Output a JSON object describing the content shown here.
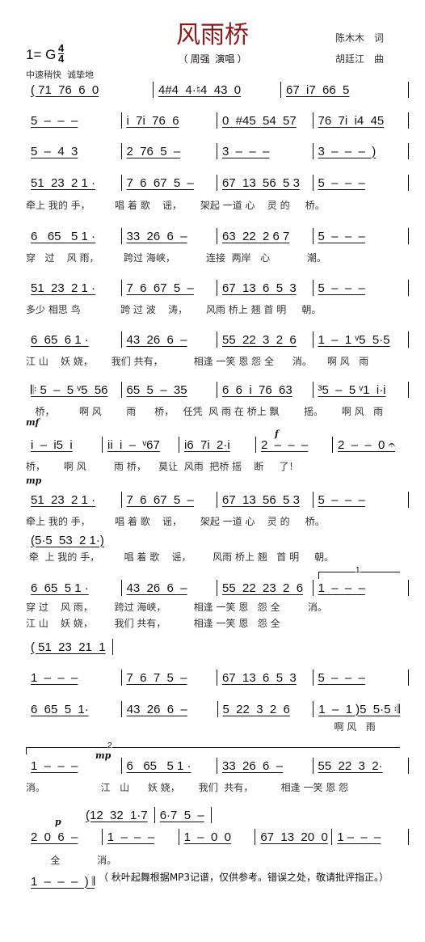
{
  "header": {
    "title": "风雨桥",
    "lyricist": "陈木木　词",
    "composer": "胡廷江　曲",
    "key": "1= G",
    "time_top": "4",
    "time_bottom": "4",
    "singer": "（ 周强  演唱 ）",
    "tempo": "中速稍快  诚挚地"
  },
  "dynamics": {
    "mf": "mf",
    "mp1": "mp",
    "f": "f",
    "mp2": "mp",
    "p": "p"
  },
  "voltas": {
    "v1": "1",
    "v2": "2"
  },
  "rows": [
    {
      "notes": [
        "( 71  76  6  0",
        "4#4  4·♮4  43  0",
        "67  i7  66  5",
        ""
      ],
      "lyrics": ""
    },
    {
      "notes": [
        "5  –  –  –",
        "i  7i  76  6",
        "0  #45  54  57",
        "76  7i  i4  45",
        ""
      ],
      "lyrics": ""
    },
    {
      "notes": [
        "5  –  4  3",
        "2  76  5  –",
        "3  –  –  –",
        "3  –  –  –  )",
        ""
      ],
      "lyrics": ""
    },
    {
      "notes": [
        "51  23  2 1 ·",
        "7  6  67  5  –",
        "67  13  56  5 3",
        "5  –  –  –",
        ""
      ],
      "lyrics": "牵上 我的 手，        唱 着 歌    谣，      架起 一道 心    灵 的     桥。"
    },
    {
      "notes": [
        "6   65   5 1 ·",
        "33  26  6  –",
        "63  22  2 6 7",
        "5  –  –  –",
        ""
      ],
      "lyrics": "穿   过    风 雨，        跨过 海峡，          连接  两岸   心            潮。"
    },
    {
      "notes": [
        "51  23  2 1 ·",
        "7  6  67  5  –",
        "67  13  6  5  3",
        "5  –  –  –",
        ""
      ],
      "lyrics": "多少 相思 鸟             跨 过 波    涛，      风雨 桥上 翘 首 明     朝。"
    },
    {
      "notes": [
        "6  65  6 1 ·",
        "43  26  6  –",
        "55  22  3  2  6",
        "1  –  1 ᵛ5  5·5",
        ""
      ],
      "lyrics": "江 山    妖 娆，      我们 共有，          相逢 一笑 恩 怨 全      消。     啊 风   雨"
    },
    {
      "notes": [
        "𝄆 5  –  5 ᵛ5  56",
        "65  5  –  35",
        "6  6  i  76  63",
        "³5  –  5 ᵛ1  i·i",
        ""
      ],
      "lyrics": "   桥，        啊 风        雨      桥，   任凭  风 雨 在 桥上 飘        摇。      啊 风   雨"
    },
    {
      "notes": [
        "i  –  i5  i",
        "ii  i  –  ᵛ67",
        "i6  7i  2·i",
        "2  –  –  –",
        "2  –  –  0 𝄐"
      ],
      "lyrics": "桥，      啊 风         雨 桥，    莫让  风雨  把桥 摇    断     了！"
    },
    {
      "notes": [
        "51  23  2 1 ·",
        "7  6  67  5  –",
        "67  13  56  5 3",
        "5  –  –  –",
        ""
      ],
      "lyrics": "牵上 我的 手，        唱 着 歌    谣，      架起 一道 心    灵 的     桥。"
    },
    {
      "notes": [
        "(5·5  53  2 1·)"
      ],
      "lyrics": " 牵  上 我的 手，        唱 着 歌    谣，       风雨 桥上 翘   首 明     朝。"
    },
    {
      "notes": [
        "6  65  5 1 ·",
        "43  26  6  –",
        "55  22  23  2  6",
        "1  –  –  –",
        ""
      ],
      "lyrics": "穿 过    风 雨，       跨过 海峡，         相逢 一笑 恩   怨 全         消。"
    },
    {
      "notes": [],
      "lyrics": "江 山    妖 娆，       我们 共有，         相逢 一笑 恩   怨 全"
    },
    {
      "notes": [
        "( 51  23  21  1",
        ""
      ],
      "lyrics": ""
    },
    {
      "notes": [
        "1  –  –  –",
        "7  6  7  5  –",
        "67  13  6  5  3",
        "5  –  –  –",
        ""
      ],
      "lyrics": ""
    },
    {
      "notes": [
        "6  65  5  1·",
        "43  26  6  –",
        "5  22  3  2  6",
        "1  –  1 )5  5·5 𝄇"
      ],
      "lyrics": "                                                                                                    啊 风   雨"
    },
    {
      "notes": [
        "1  –  –  –",
        "6   65   5 1 ·",
        "33  26  6  –",
        "55  22  3  2·",
        ""
      ],
      "lyrics": "消。                  江   山      妖 娆，      我们  共有，         相逢 一笑 恩 怨"
    },
    {
      "notes": [
        "(12  32  1·7",
        "6·7  5  –",
        ""
      ],
      "lyrics": ""
    },
    {
      "notes": [
        "2  0  6  –",
        "1  –  –  –",
        "1  –  0  0",
        "67  13  20  0",
        "1 –  –  –",
        ""
      ],
      "lyrics": "        全            消。"
    },
    {
      "notes": [
        "1  –  –  –  ) 𝄂"
      ],
      "lyrics": ""
    }
  ],
  "footer_note": "（ 秋叶起舞根据MP3记谱，仅供参考。错误之处，敬请批评指正。）"
}
